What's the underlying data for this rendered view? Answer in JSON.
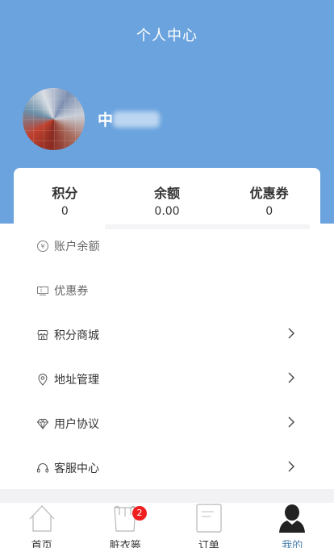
{
  "header": {
    "title": "个人中心",
    "background_color": "#6aa3de"
  },
  "user": {
    "name": "中",
    "avatar_icon": "avatar-photo"
  },
  "stats": [
    {
      "label": "积分",
      "value": "0"
    },
    {
      "label": "余额",
      "value": "0.00"
    },
    {
      "label": "优惠券",
      "value": "0"
    }
  ],
  "menu": [
    {
      "label": "账户余额",
      "icon": "yen-wallet-icon"
    },
    {
      "label": "优惠券",
      "icon": "coupon-icon"
    },
    {
      "label": "积分商城",
      "icon": "store-icon"
    },
    {
      "label": "地址管理",
      "icon": "location-pin-icon"
    },
    {
      "label": "用户协议",
      "icon": "diamond-icon"
    },
    {
      "label": "客服中心",
      "icon": "headset-icon"
    }
  ],
  "tabbar": {
    "items": [
      {
        "label": "首页",
        "icon": "home-icon"
      },
      {
        "label": "脏衣篓",
        "icon": "laundry-basket-icon",
        "badge": "2"
      },
      {
        "label": "订单",
        "icon": "order-document-icon"
      },
      {
        "label": "我的",
        "icon": "profile-icon",
        "active": true
      }
    ],
    "active_color": "#4a7fae",
    "badge_color": "#ef1f1f"
  }
}
